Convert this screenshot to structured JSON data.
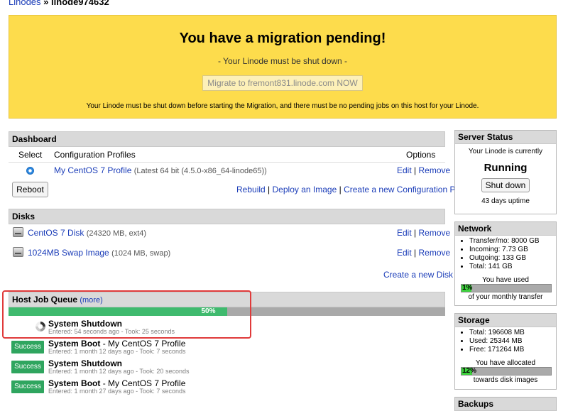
{
  "breadcrumb": {
    "root": "Linodes",
    "separator": "»",
    "current": "linode974632"
  },
  "migration": {
    "title": "You have a migration pending!",
    "subtitle": "- Your Linode must be shut down -",
    "button": "Migrate to fremont831.linode.com NOW",
    "note": "Your Linode must be shut down before starting the Migration, and there must be no pending jobs on this host for your Linode."
  },
  "dashboard": {
    "title": "Dashboard",
    "col_select": "Select",
    "col_profiles": "Configuration Profiles",
    "col_options": "Options",
    "profile": {
      "name": "My CentOS 7 Profile",
      "detail": "(Latest 64 bit (4.5.0-x86_64-linode65))",
      "edit": "Edit",
      "remove": "Remove"
    },
    "reboot": "Reboot",
    "links": {
      "rebuild": "Rebuild",
      "deploy": "Deploy an Image",
      "create_profile": "Create a new Configuration Profile"
    },
    "sep": "|"
  },
  "disks": {
    "title": "Disks",
    "items": [
      {
        "name": "CentOS 7 Disk",
        "detail": "(24320 MB, ext4)",
        "edit": "Edit",
        "remove": "Remove"
      },
      {
        "name": "1024MB Swap Image",
        "detail": "(1024 MB, swap)",
        "edit": "Edit",
        "remove": "Remove"
      }
    ],
    "create": "Create a new Disk"
  },
  "queue": {
    "title": "Host Job Queue",
    "more": "(more)",
    "progress_label": "50%",
    "progress": 0.5,
    "current_job": {
      "title": "System Shutdown",
      "meta": "Entered: 54 seconds ago - Took: 25 seconds"
    },
    "jobs": [
      {
        "status": "Success",
        "title": "System Boot",
        "suffix": " - My CentOS 7 Profile",
        "meta": "Entered: 1 month 12 days ago - Took: 7 seconds"
      },
      {
        "status": "Success",
        "title": "System Shutdown",
        "suffix": "",
        "meta": "Entered: 1 month 12 days ago - Took: 20 seconds"
      },
      {
        "status": "Success",
        "title": "System Boot",
        "suffix": " - My CentOS 7 Profile",
        "meta": "Entered: 1 month 27 days ago - Took: 7 seconds"
      }
    ]
  },
  "server_status": {
    "title": "Server Status",
    "line": "Your Linode is currently",
    "state": "Running",
    "button": "Shut down",
    "uptime": "43 days uptime"
  },
  "network": {
    "title": "Network",
    "items": [
      "Transfer/mo: 8000 GB",
      "Incoming: 7.73 GB",
      "Outgoing: 133 GB",
      "Total: 141 GB"
    ],
    "used_label": "You have used",
    "percent_label": "1%",
    "percent": 0.01,
    "footer": "of your monthly transfer"
  },
  "storage": {
    "title": "Storage",
    "items": [
      "Total: 196608 MB",
      "Used: 25344 MB",
      "Free: 171264 MB"
    ],
    "alloc_label": "You have allocated",
    "percent_label": "12%",
    "percent": 0.12,
    "footer": "towards disk images"
  },
  "backups": {
    "title": "Backups"
  },
  "colors": {
    "accent_green": "#3fba6e",
    "banner_yellow": "#fddc4c",
    "link_blue": "#1a3cb8",
    "highlight_red": "#e03a3a"
  }
}
